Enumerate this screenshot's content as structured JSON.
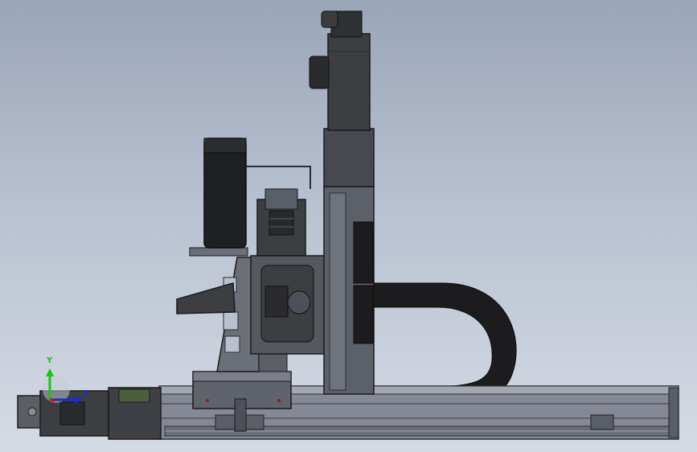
{
  "app": "CAD 3D viewport",
  "view": {
    "name": "front",
    "model": "gantry-robot-assembly"
  },
  "triad": {
    "y_label": "Y",
    "z_label": "Z",
    "y_color": "#17c417",
    "z_color": "#1a2bd6",
    "x_color": "#d41818"
  },
  "colors": {
    "background_top": "#9aa5b8",
    "background_bottom": "#d5dbe4",
    "metal_dark": "#3c3e42",
    "metal_mid": "#6b6f78",
    "rail": "#858996",
    "cable_chain": "#1c1c1e",
    "accent_green": "#4a5f3a"
  }
}
